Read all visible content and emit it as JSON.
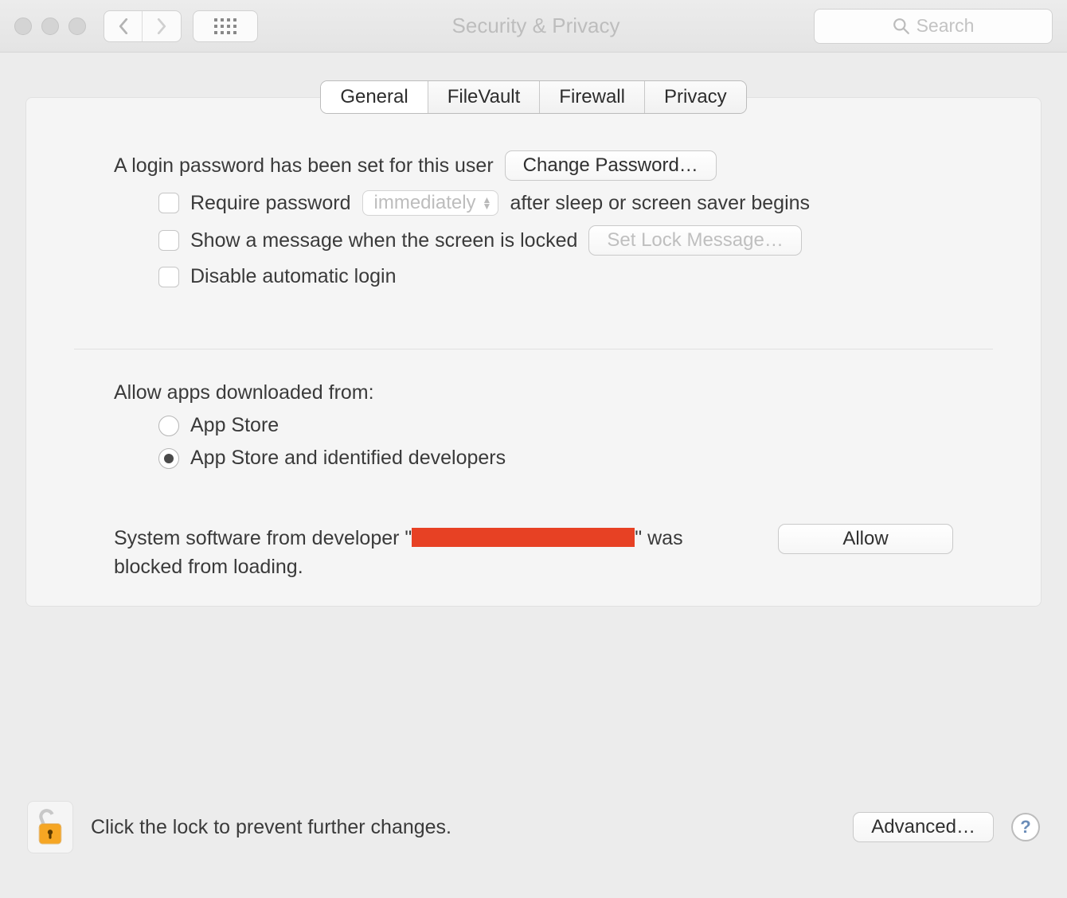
{
  "header": {
    "title": "Security & Privacy",
    "search_placeholder": "Search"
  },
  "tabs": {
    "general": "General",
    "filevault": "FileVault",
    "firewall": "Firewall",
    "privacy": "Privacy",
    "active": "general"
  },
  "login": {
    "text": "A login password has been set for this user",
    "change_button": "Change Password…",
    "require_password_label_before": "Require password",
    "require_password_select": "immediately",
    "require_password_label_after": "after sleep or screen saver begins",
    "show_message_label": "Show a message when the screen is locked",
    "set_lock_button": "Set Lock Message…",
    "disable_auto_login": "Disable automatic login"
  },
  "downloads": {
    "heading": "Allow apps downloaded from:",
    "option_appstore": "App Store",
    "option_identified": "App Store and identified developers",
    "selected": "identified"
  },
  "blocked": {
    "prefix": "System software from developer \"",
    "suffix": "\" was blocked from loading.",
    "allow_button": "Allow"
  },
  "footer": {
    "lock_text": "Click the lock to prevent further changes.",
    "advanced_button": "Advanced…",
    "help": "?"
  }
}
